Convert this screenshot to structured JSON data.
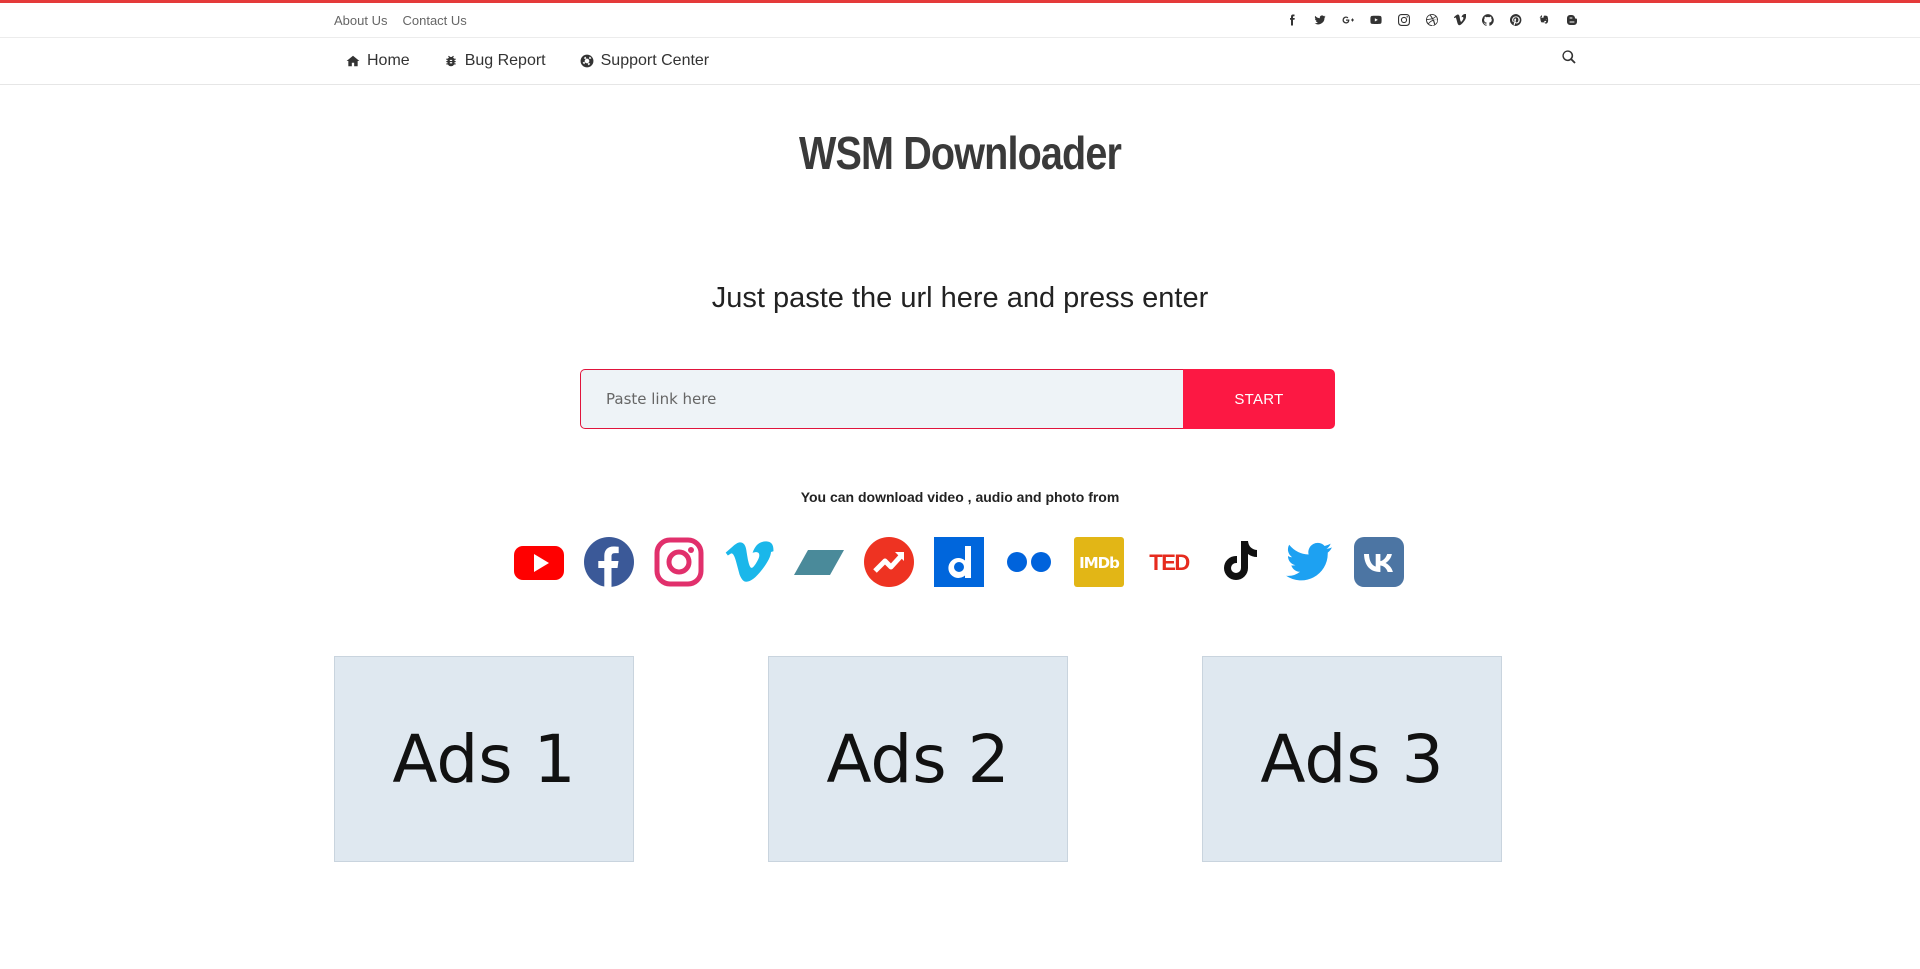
{
  "topbar": {
    "links": [
      "About Us",
      "Contact Us"
    ],
    "social_icons": [
      "facebook-icon",
      "twitter-icon",
      "google-plus-icon",
      "youtube-icon",
      "instagram-icon",
      "dribbble-icon",
      "vimeo-icon",
      "github-icon",
      "pinterest-icon",
      "evernote-icon",
      "blogger-icon"
    ]
  },
  "nav": {
    "items": [
      {
        "label": "Home",
        "icon": "home-icon"
      },
      {
        "label": "Bug Report",
        "icon": "bug-icon"
      },
      {
        "label": "Support Center",
        "icon": "life-ring-icon"
      }
    ],
    "search_icon": "search-icon"
  },
  "hero": {
    "logo": "WSM Downloader",
    "tagline": "Just paste the url here and press enter"
  },
  "form": {
    "placeholder": "Paste link here",
    "button_label": "START"
  },
  "supported": {
    "note": "You can download video , audio and photo from",
    "platforms": [
      "YouTube",
      "Facebook",
      "Instagram",
      "Vimeo",
      "Kickstarter-like",
      "Buzzfeed",
      "Dailymotion",
      "Flickr",
      "IMDb",
      "TED",
      "TikTok",
      "Twitter",
      "VK"
    ]
  },
  "ads": [
    "Ads 1",
    "Ads 2",
    "Ads 3"
  ],
  "colors": {
    "accent": "#fc1843",
    "top_accent": "#e43a3a",
    "input_bg": "#eef3f7",
    "ad_bg": "#dfe8f0"
  }
}
